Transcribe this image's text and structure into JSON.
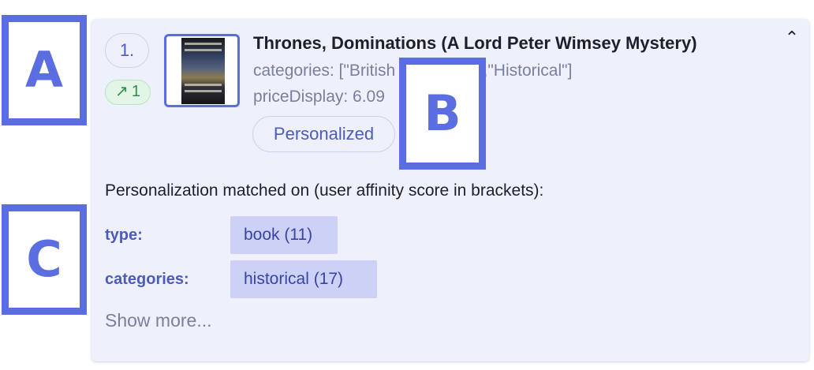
{
  "item": {
    "rank": "1.",
    "rank_change_arrow": "↗",
    "rank_change_value": "1",
    "title": "Thrones, Dominations (A Lord Peter Wimsey Mystery)",
    "categories_line": "categories: [\"British Detectives\",\"Historical\"]",
    "price_line": "priceDisplay: 6.09",
    "tag": "Personalized",
    "collapse_icon": "⌃"
  },
  "personalization": {
    "heading": "Personalization matched on (user affinity score in brackets):",
    "attributes": [
      {
        "label": "type:",
        "value": "book (11)"
      },
      {
        "label": "categories:",
        "value": "historical (17)"
      }
    ],
    "show_more": "Show more..."
  },
  "overlays": {
    "a": "A",
    "b": "B",
    "c": "C"
  },
  "colors": {
    "accent": "#5b6ee1",
    "card_bg": "#eef0fb",
    "chip_bg": "#cdd1f5",
    "success": "#2f8f4a"
  }
}
